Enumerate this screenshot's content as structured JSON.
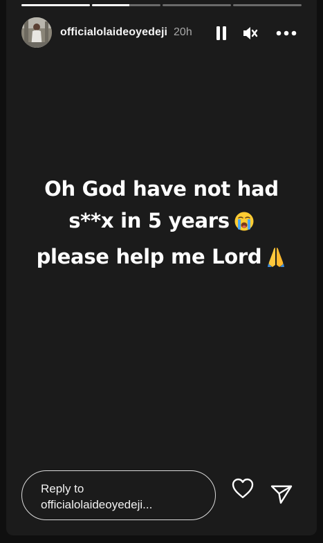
{
  "story": {
    "progress": [
      1.0,
      0.55,
      0.0,
      0.0
    ],
    "username": "officialolaideoyedeji",
    "time_ago": "20h",
    "text_lines": [
      "Oh God have not had",
      "s**x in 5 years",
      "please help me Lord"
    ],
    "emojis": [
      "loudly-crying-face",
      "folded-hands"
    ]
  },
  "reply": {
    "line1": "Reply to",
    "line2": "officialolaideoyedeji..."
  },
  "icons": [
    "pause-icon",
    "mute-icon",
    "more-icon",
    "heart-icon",
    "send-icon"
  ],
  "colors": {
    "background": "#1b1b1b",
    "text": "#ffffff",
    "muted_text": "#a8a8a8"
  }
}
